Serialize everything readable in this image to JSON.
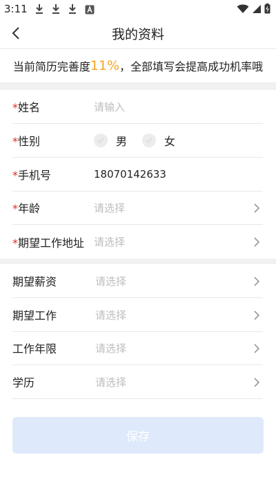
{
  "status_bar": {
    "time": "3:11"
  },
  "header": {
    "title": "我的资料"
  },
  "banner": {
    "prefix": "当前简历完善度",
    "percent": "11%",
    "suffix": "，全部填写会提高成功机率哦"
  },
  "required_mark": "*",
  "basic_info": {
    "name": {
      "label": "姓名",
      "placeholder": "请输入"
    },
    "gender": {
      "label": "性别",
      "options": [
        "男",
        "女"
      ]
    },
    "phone": {
      "label": "手机号",
      "value": "18070142633"
    },
    "age": {
      "label": "年龄",
      "placeholder": "请选择"
    },
    "work_location": {
      "label": "期望工作地址",
      "placeholder": "请选择"
    }
  },
  "job_info": {
    "salary": {
      "label": "期望薪资",
      "placeholder": "请选择"
    },
    "job": {
      "label": "期望工作",
      "placeholder": "请选择"
    },
    "years": {
      "label": "工作年限",
      "placeholder": "请选择"
    },
    "education": {
      "label": "学历",
      "placeholder": "请选择"
    }
  },
  "save_button": {
    "label": "保存"
  },
  "colors": {
    "accent_percent": "#f5a623",
    "required": "#e02e24",
    "save_button_bg": "#deeafb",
    "placeholder": "#bdbdbd"
  }
}
